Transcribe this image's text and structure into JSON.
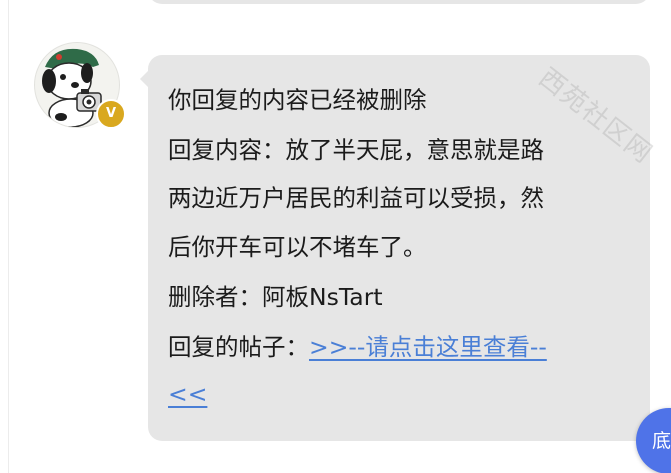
{
  "avatar": {
    "icon": "dog-with-camera-avatar"
  },
  "badge": {
    "text": "V",
    "color": "#d9a81f"
  },
  "message": {
    "lines": [
      "你回复的内容已经被删除",
      "回复内容：放了半天屁，意思就是路",
      "两边近万户居民的利益可以受损，然",
      "后你开车可以不堵车了。",
      "删除者：阿板NsTart"
    ],
    "post_label": "回复的帖子：",
    "post_link_line1": ">>--请点击这里查看--",
    "post_link_line2": "<<"
  },
  "watermark": {
    "text": "西苑社区网"
  },
  "scroll_bottom": {
    "label": "底"
  },
  "colors": {
    "bubble": "#e6e6e6",
    "link": "#4a7fd6",
    "button": "#4f73e8"
  }
}
